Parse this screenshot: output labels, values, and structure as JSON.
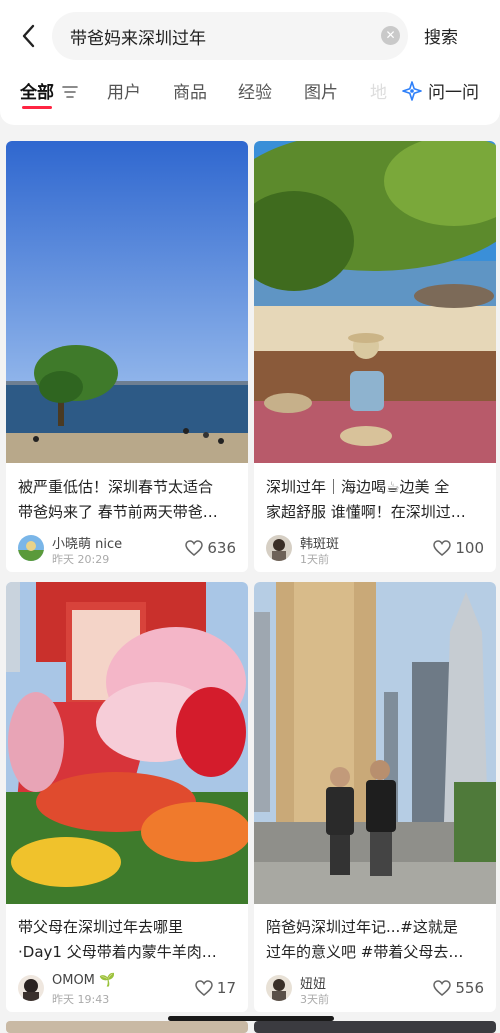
{
  "search": {
    "query": "带爸妈来深圳过年",
    "button_label": "搜索"
  },
  "tabs": [
    {
      "label": "全部",
      "active": true
    },
    {
      "label": "用户"
    },
    {
      "label": "商品"
    },
    {
      "label": "经验"
    },
    {
      "label": "图片"
    },
    {
      "label": "地"
    }
  ],
  "ask_label": "问一问",
  "accent_color": "#ff2442",
  "posts": [
    {
      "title_line1": "被严重低估！深圳春节太适合",
      "title_line2": "带爸妈来了 春节前两天带爸…",
      "author": "小晓萌 nice",
      "time": "昨天 20:29",
      "likes": "636"
    },
    {
      "title_line1": "深圳过年｜海边喝☕边美 全",
      "title_line2": "家超舒服 谁懂啊！在深圳过…",
      "author": "韩斑斑",
      "time": "1天前",
      "likes": "100"
    },
    {
      "title_line1": "带父母在深圳过年去哪里",
      "title_line2": "·Day1 父母带着内蒙牛羊肉…",
      "author": "OMOM 🌱",
      "time": "昨天 19:43",
      "likes": "17"
    },
    {
      "title_line1": "陪爸妈深圳过年记...#这就是",
      "title_line2": "过年的意义吧 #带着父母去…",
      "author": "妞妞",
      "time": "3天前",
      "likes": "556"
    }
  ],
  "icons": {
    "back": "chevron-left-icon",
    "clear": "clear-icon",
    "filter": "filter-icon",
    "ask": "sparkle-icon",
    "like": "heart-icon"
  }
}
